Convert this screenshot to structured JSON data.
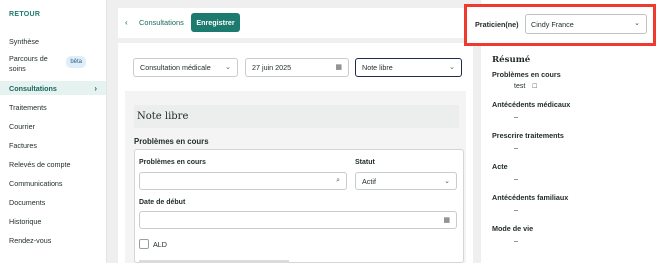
{
  "sidebar": {
    "brand": "RETOUR",
    "items": [
      {
        "label": "Synthèse"
      },
      {
        "label_line1": "Parcours de",
        "label_line2": "soins",
        "badge": "bêta"
      },
      {
        "label": "Consultations",
        "active": true
      },
      {
        "label": "Traitements"
      },
      {
        "label": "Courrier"
      },
      {
        "label": "Factures"
      },
      {
        "label": "Relevés de compte"
      },
      {
        "label": "Communications"
      },
      {
        "label": "Documents"
      },
      {
        "label": "Historique"
      },
      {
        "label": "Rendez-vous"
      }
    ]
  },
  "topbar": {
    "back_label": "Consultations",
    "save_label": "Enregistrer"
  },
  "controls": {
    "type": "Consultation médicale",
    "date": "27 juin 2025",
    "note_type": "Note libre"
  },
  "content": {
    "note_title": "Note libre",
    "section_title": "Problèmes en cours",
    "problem_label": "Problèmes en cours",
    "problem_value": "",
    "status_label": "Statut",
    "status_value": "Actif",
    "start_label": "Date de début",
    "start_value": "",
    "ald_label": "ALD"
  },
  "practitioner": {
    "label": "Praticien(ne)",
    "value": "Cindy France"
  },
  "summary": {
    "title": "Résumé",
    "sections": [
      {
        "label": "Problèmes en cours",
        "value": "test"
      },
      {
        "label": "Antécédents médicaux",
        "value": "–"
      },
      {
        "label": "Prescrire traitements",
        "value": "–"
      },
      {
        "label": "Acte",
        "value": "–"
      },
      {
        "label": "Antécédents familiaux",
        "value": "–"
      },
      {
        "label": "Mode de vie",
        "value": "–"
      }
    ]
  },
  "colors": {
    "accent": "#1d7a6e",
    "highlight": "#ef3b2f"
  }
}
